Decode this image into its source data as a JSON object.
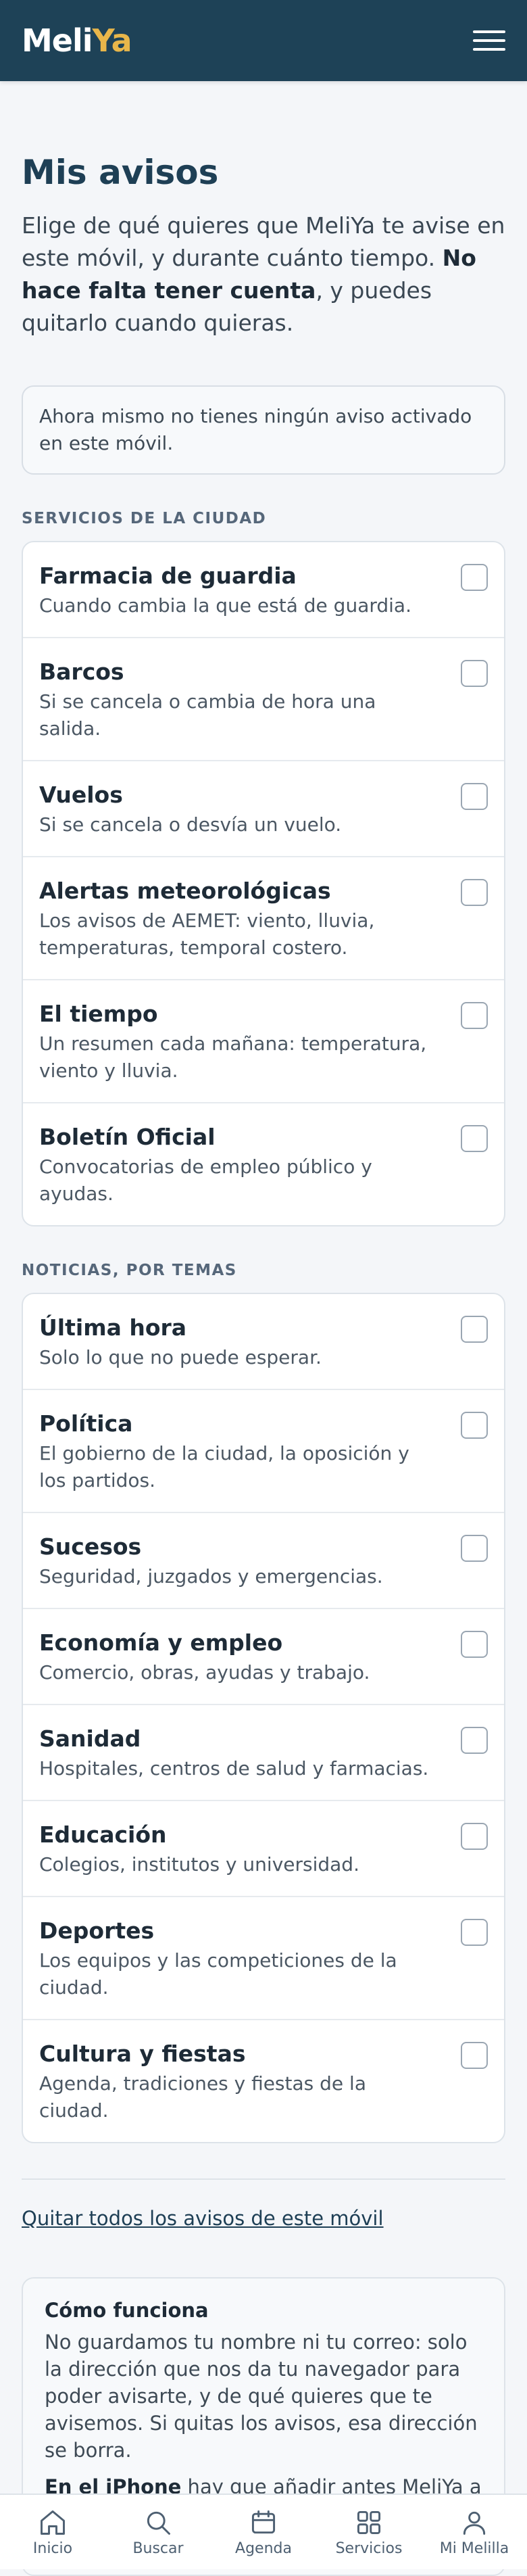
{
  "header": {
    "logo_part1": "Meli",
    "logo_part2": "Ya",
    "menu_icon": "hamburger-menu-icon"
  },
  "page": {
    "title": "Mis avisos",
    "intro_text": "Elige de qué quieres que MeliYa te avise en este móvil, y durante cuánto tiempo. ",
    "intro_bold": "No hace falta tener cuenta",
    "intro_tail": ", y puedes quitarlo cuando quieras.",
    "status_notice": "Ahora mismo no tienes ningún aviso activado en este móvil."
  },
  "services": {
    "heading": "SERVICIOS DE LA CIUDAD",
    "items": [
      {
        "title": "Farmacia de guardia",
        "desc": "Cuando cambia la que está de guardia."
      },
      {
        "title": "Barcos",
        "desc": "Si se cancela o cambia de hora una salida."
      },
      {
        "title": "Vuelos",
        "desc": "Si se cancela o desvía un vuelo."
      },
      {
        "title": "Alertas meteorológicas",
        "desc": "Los avisos de AEMET: viento, lluvia, temperaturas, temporal costero."
      },
      {
        "title": "El tiempo",
        "desc": "Un resumen cada mañana: temperatura, viento y lluvia."
      },
      {
        "title": "Boletín Oficial",
        "desc": "Convocatorias de empleo público y ayudas."
      }
    ]
  },
  "news": {
    "heading": "NOTICIAS, POR TEMAS",
    "items": [
      {
        "title": "Última hora",
        "desc": "Solo lo que no puede esperar."
      },
      {
        "title": "Política",
        "desc": "El gobierno de la ciudad, la oposición y los partidos."
      },
      {
        "title": "Sucesos",
        "desc": "Seguridad, juzgados y emergencias."
      },
      {
        "title": "Economía y empleo",
        "desc": "Comercio, obras, ayudas y trabajo."
      },
      {
        "title": "Sanidad",
        "desc": "Hospitales, centros de salud y farmacias."
      },
      {
        "title": "Educación",
        "desc": "Colegios, institutos y universidad."
      },
      {
        "title": "Deportes",
        "desc": "Los equipos y las competiciones de la ciudad."
      },
      {
        "title": "Cultura y fiestas",
        "desc": "Agenda, tradiciones y fiestas de la ciudad."
      }
    ]
  },
  "remove_all_link": "Quitar todos los avisos de este móvil",
  "how_it_works": {
    "title": "Cómo funciona",
    "p1": "No guardamos tu nombre ni tu correo: solo la dirección que nos da tu navegador para poder avisarte, y de qué quieres que te avisemos. Si quitas los avisos, esa dirección se borra.",
    "p2_bold": "En el iPhone",
    "p2_rest": " hay que añadir antes MeliYa a la pantalla de inicio: Safari solo permite avisos a lo que está instalado."
  },
  "bottom_nav": [
    {
      "label": "Inicio",
      "icon": "home-icon"
    },
    {
      "label": "Buscar",
      "icon": "search-icon"
    },
    {
      "label": "Agenda",
      "icon": "calendar-icon"
    },
    {
      "label": "Servicios",
      "icon": "grid-icon"
    },
    {
      "label": "Mi Melilla",
      "icon": "user-icon"
    }
  ],
  "colors": {
    "header_bg": "#1e4257",
    "logo_accent": "#e8b64a",
    "title": "#1e3f55"
  }
}
